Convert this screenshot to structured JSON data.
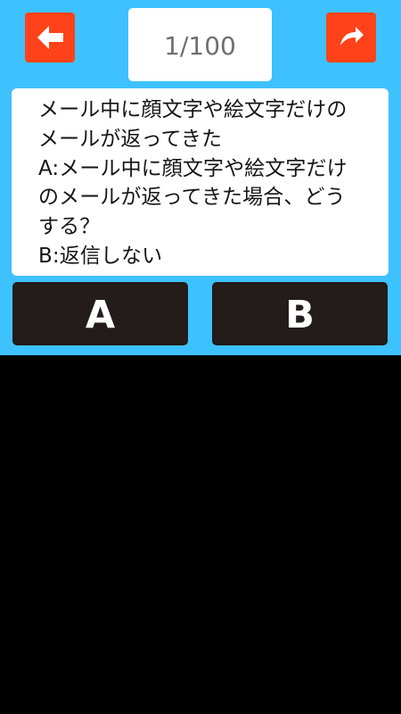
{
  "header": {
    "progress": "1/100",
    "back_icon": "back-arrow-icon",
    "share_icon": "share-arrow-icon"
  },
  "question": {
    "title": "メール中に顔文字や絵文字だけのメールが返ってきた",
    "option_a": "A:メール中に顔文字や絵文字だけのメールが返ってきた場合、どうする？",
    "option_b": "B:返信しない"
  },
  "answers": {
    "a_label": "A",
    "b_label": "B"
  },
  "colors": {
    "background": "#3ec2ff",
    "button_orange": "#ff4219",
    "answer_button": "#231c1a",
    "card": "#ffffff",
    "lower_screen": "#000000"
  }
}
